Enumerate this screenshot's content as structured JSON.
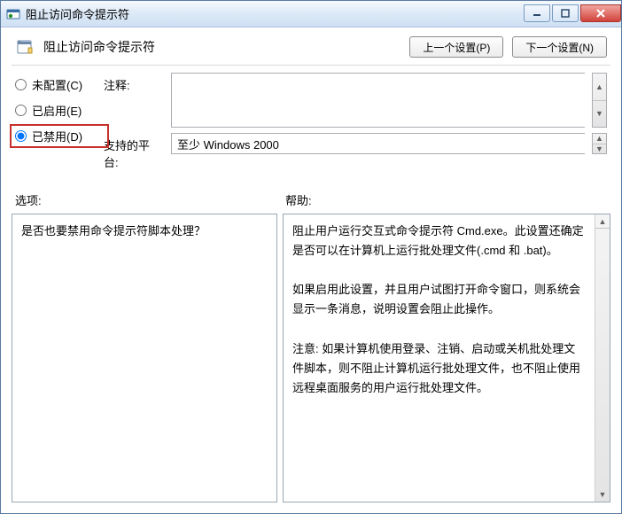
{
  "window": {
    "title": "阻止访问命令提示符"
  },
  "header": {
    "title": "阻止访问命令提示符",
    "prev_button": "上一个设置(P)",
    "next_button": "下一个设置(N)"
  },
  "config": {
    "not_configured": "未配置(C)",
    "enabled": "已启用(E)",
    "disabled": "已禁用(D)",
    "selected": "disabled"
  },
  "fields": {
    "comment_label": "注释:",
    "comment_value": "",
    "platform_label": "支持的平台:",
    "platform_value": "至少 Windows 2000"
  },
  "lower": {
    "options_label": "选项:",
    "help_label": "帮助:",
    "options_text": "是否也要禁用命令提示符脚本处理？",
    "help_text": "阻止用户运行交互式命令提示符 Cmd.exe。此设置还确定是否可以在计算机上运行批处理文件(.cmd 和 .bat)。\n\n如果启用此设置，并且用户试图打开命令窗口，则系统会显示一条消息，说明设置会阻止此操作。\n\n注意: 如果计算机使用登录、注销、启动或关机批处理文件脚本，则不阻止计算机运行批处理文件，也不阻止使用远程桌面服务的用户运行批处理文件。"
  }
}
